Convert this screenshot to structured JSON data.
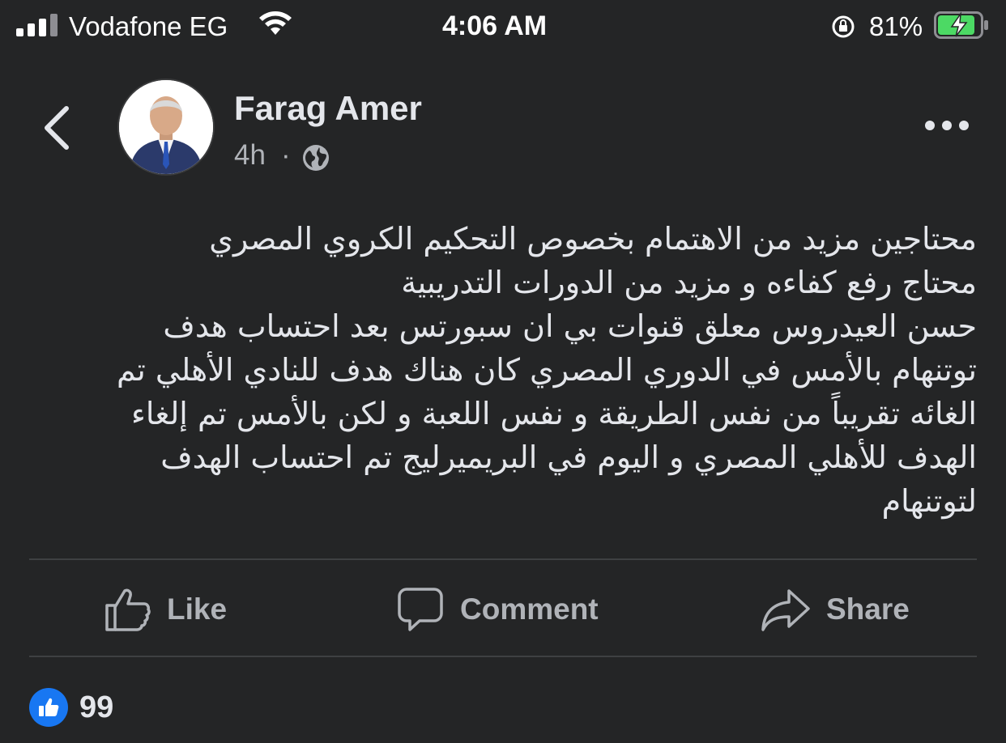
{
  "status_bar": {
    "carrier": "Vodafone EG",
    "time": "4:06 AM",
    "battery_percent": "81%",
    "battery_level": 0.81
  },
  "header": {
    "author_name": "Farag Amer",
    "timestamp": "4h",
    "separator": "·",
    "privacy_icon": "globe-icon",
    "back_icon": "chevron-left-icon",
    "more_icon": "more-horizontal-icon"
  },
  "post": {
    "lines": [
      "محتاجين مزيد من الاهتمام بخصوص التحكيم الكروي المصري",
      "محتاج رفع كفاءه و مزيد من الدورات التدريبية",
      "حسن العيدروس معلق قنوات بي ان سبورتس بعد احتساب هدف",
      "توتنهام بالأمس في الدوري المصري كان هناك هدف للنادي الأهلي تم",
      "الغائه تقريباً من نفس الطريقة و نفس اللعبة و لكن بالأمس تم إلغاء",
      "الهدف للأهلي المصري و اليوم في البريميرليج تم احتساب الهدف",
      "لتوتنهام"
    ]
  },
  "actions": {
    "like": "Like",
    "comment": "Comment",
    "share": "Share"
  },
  "reactions": {
    "count": "99",
    "icon": "thumbs-up-icon"
  },
  "colors": {
    "background": "#242526",
    "text_primary": "#e4e6eb",
    "text_secondary": "#b0b3b8",
    "divider": "#3e4042",
    "accent": "#1877f2",
    "battery_green": "#4cd964"
  }
}
